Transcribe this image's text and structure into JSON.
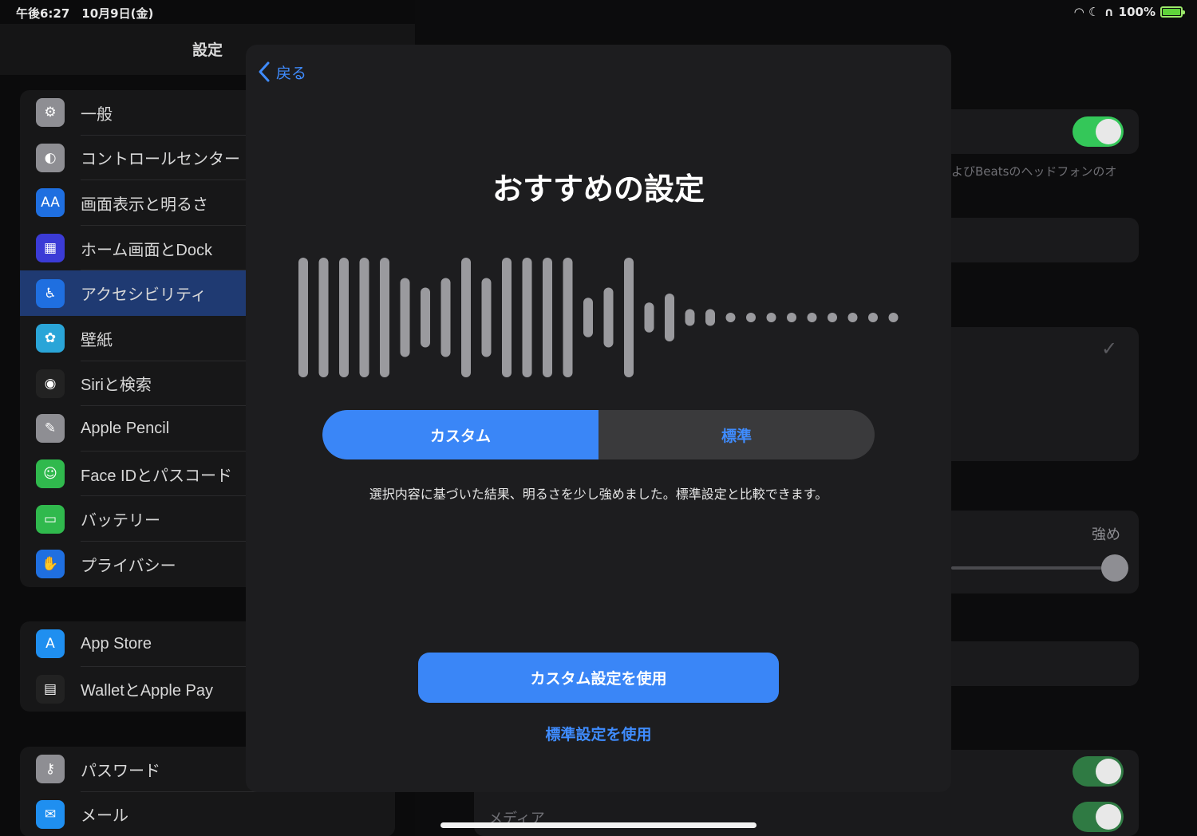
{
  "status_bar": {
    "time_date": "午後6:27　10月9日(金)",
    "battery": "100%"
  },
  "sidebar": {
    "title": "設定",
    "groups": [
      [
        {
          "label": "一般",
          "icon": "gear-icon",
          "color": "#8e8e93"
        },
        {
          "label": "コントロールセンター",
          "icon": "toggles-icon",
          "color": "#8e8e93"
        },
        {
          "label": "画面表示と明るさ",
          "icon": "text-size-icon",
          "color": "#1f6fe0"
        },
        {
          "label": "ホーム画面とDock",
          "icon": "grid-icon",
          "color": "#3b3bd6"
        },
        {
          "label": "アクセシビリティ",
          "icon": "accessibility-icon",
          "color": "#1f6fe0",
          "selected": true
        },
        {
          "label": "壁紙",
          "icon": "flower-icon",
          "color": "#2aa5d8"
        },
        {
          "label": "Siriと検索",
          "icon": "siri-icon",
          "color": "#222"
        },
        {
          "label": "Apple Pencil",
          "icon": "pencil-icon",
          "color": "#8e8e93"
        },
        {
          "label": "Face IDとパスコード",
          "icon": "face-id-icon",
          "color": "#30b94d"
        },
        {
          "label": "バッテリー",
          "icon": "battery-icon",
          "color": "#30b94d"
        },
        {
          "label": "プライバシー",
          "icon": "hand-icon",
          "color": "#1f6fe0"
        }
      ],
      [
        {
          "label": "App Store",
          "icon": "app-store-icon",
          "color": "#1f8ff0"
        },
        {
          "label": "WalletとApple Pay",
          "icon": "wallet-icon",
          "color": "#222"
        }
      ],
      [
        {
          "label": "パスワード",
          "icon": "key-icon",
          "color": "#8e8e93"
        },
        {
          "label": "メール",
          "icon": "mail-icon",
          "color": "#1f8ff0"
        }
      ]
    ]
  },
  "detail": {
    "beats_note": "よびBeatsのヘッドフォンのオ",
    "slider_label": "強め",
    "media_label": "メディア"
  },
  "modal": {
    "back_label": "戻る",
    "title": "おすすめの設定",
    "segments": [
      "カスタム",
      "標準"
    ],
    "selected_segment": "カスタム",
    "description": "選択内容に基づいた結果、明るさを少し強めました。標準設定と比較できます。",
    "primary_button": "カスタム設定を使用",
    "secondary_button": "標準設定を使用",
    "waveform_levels": [
      1,
      1,
      1,
      1,
      1,
      0.66,
      0.5,
      0.66,
      1,
      0.66,
      1,
      1,
      1,
      1,
      0.33,
      0.5,
      1,
      0.25,
      0.4,
      0.14,
      0.14,
      0,
      0,
      0,
      0,
      0,
      0,
      0,
      0,
      0
    ]
  },
  "colors": {
    "accent": "#3a86f7",
    "toggle_on": "#34c759"
  }
}
